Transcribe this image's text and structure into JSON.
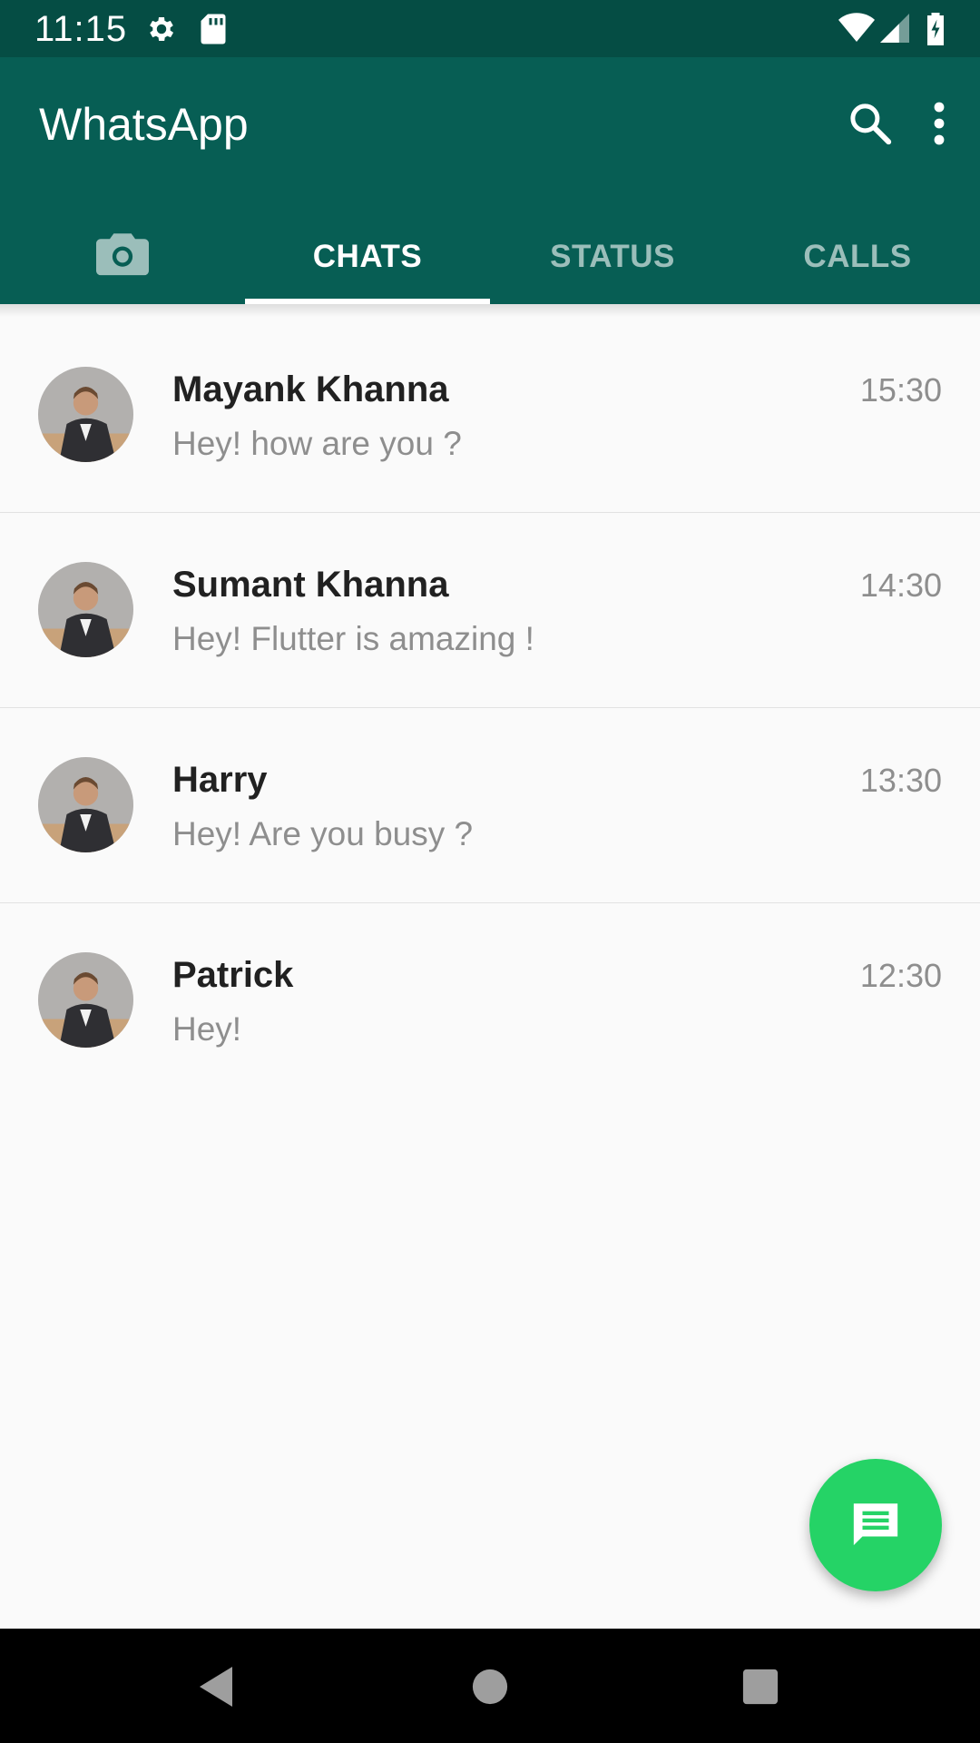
{
  "status_bar": {
    "time": "11:15",
    "icons": [
      "gear-icon",
      "sd-card-icon",
      "wifi-icon",
      "signal-icon",
      "battery-charging-icon"
    ]
  },
  "app_bar": {
    "title": "WhatsApp",
    "actions": [
      "search-icon",
      "more-vert-icon"
    ]
  },
  "tabs": [
    {
      "label": "",
      "icon": "camera-icon",
      "active": false
    },
    {
      "label": "CHATS",
      "active": true
    },
    {
      "label": "STATUS",
      "active": false
    },
    {
      "label": "CALLS",
      "active": false
    }
  ],
  "chats": [
    {
      "name": "Mayank Khanna",
      "message": "Hey! how are you ?",
      "time": "15:30"
    },
    {
      "name": "Sumant Khanna",
      "message": "Hey! Flutter is amazing !",
      "time": "14:30"
    },
    {
      "name": "Harry",
      "message": "Hey! Are you busy ?",
      "time": "13:30"
    },
    {
      "name": "Patrick",
      "message": "Hey!",
      "time": "12:30"
    }
  ],
  "fab": {
    "icon": "message-icon"
  },
  "colors": {
    "status_bar": "#054d44",
    "app_bar": "#075e54",
    "fab": "#25d366",
    "name_text": "#212121",
    "secondary_text": "#8e8e8e"
  },
  "navigation": [
    "back-icon",
    "home-icon",
    "recents-icon"
  ]
}
